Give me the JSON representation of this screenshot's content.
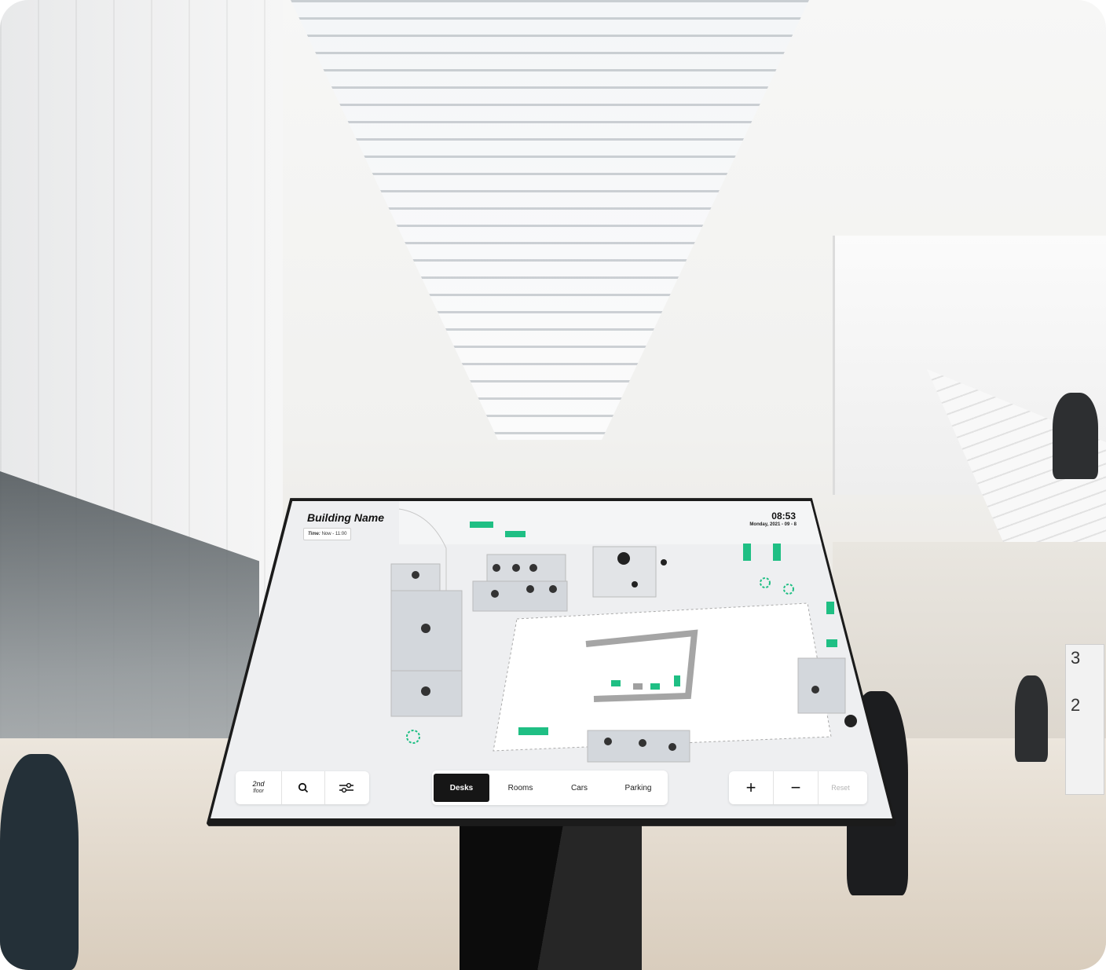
{
  "header": {
    "building_name": "Building Name",
    "time_label": "Time:",
    "time_value": "Now - 11:00",
    "clock": "08:53",
    "date": "Monday, 2021 - 09 - 8"
  },
  "floor_selector": {
    "floor": "2nd",
    "floor_suffix": "floor"
  },
  "tabs": [
    {
      "label": "Desks",
      "active": true
    },
    {
      "label": "Rooms",
      "active": false
    },
    {
      "label": "Cars",
      "active": false
    },
    {
      "label": "Parking",
      "active": false
    }
  ],
  "zoom": {
    "zoom_in": "+",
    "zoom_out": "−",
    "reset": "Reset"
  },
  "sign": {
    "levels": [
      "3",
      "2"
    ]
  },
  "colors": {
    "accent_green": "#1fbf84",
    "active_tab": "#161616",
    "screen_bg": "#eeeff1"
  }
}
